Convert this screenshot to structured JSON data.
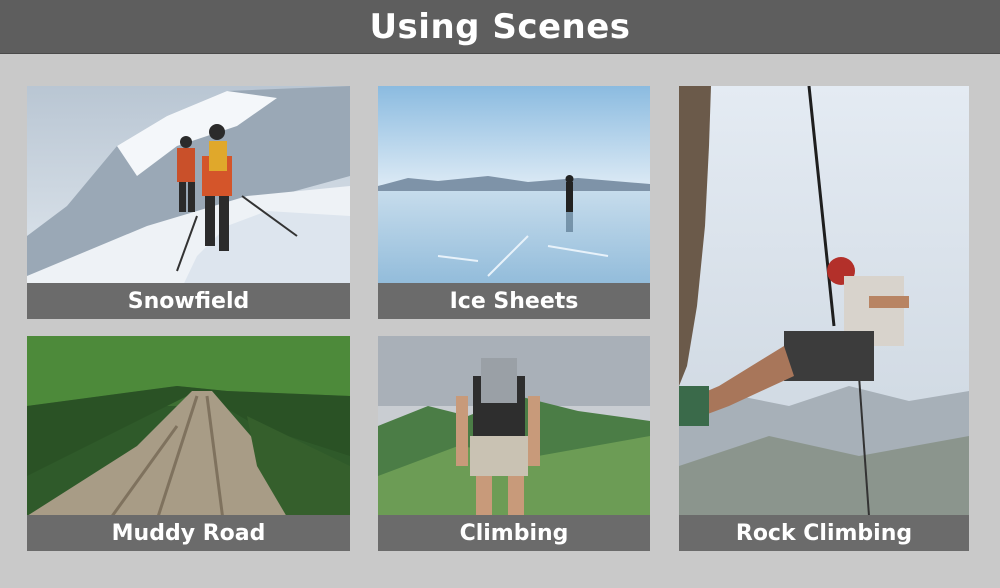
{
  "header": {
    "title": "Using Scenes"
  },
  "scenes": [
    {
      "label": "Snowfield",
      "image": "snowfield-photo"
    },
    {
      "label": "Ice Sheets",
      "image": "ice-sheets-photo"
    },
    {
      "label": "Muddy Road",
      "image": "muddy-road-photo"
    },
    {
      "label": "Climbing",
      "image": "climbing-photo"
    },
    {
      "label": "Rock Climbing",
      "image": "rock-climbing-photo"
    }
  ],
  "colors": {
    "header_bg": "#5e5e5e",
    "caption_bg": "#6b6b6b",
    "page_bg": "#c9c9c9",
    "text": "#ffffff"
  }
}
